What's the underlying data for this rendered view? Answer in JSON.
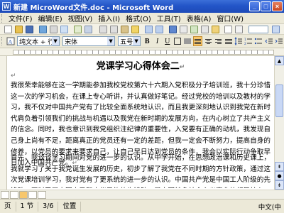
{
  "window": {
    "title": "新建 MicroWord文件.doc - Microsoft Word",
    "app_icon": "W",
    "minimize": "_",
    "maximize": "□",
    "close": "×"
  },
  "menu": [
    "文件(F)",
    "编辑(E)",
    "视图(V)",
    "插入(I)",
    "格式(O)",
    "工具(T)",
    "表格(A)",
    "窗口(W)"
  ],
  "format_toolbar": {
    "style": "纯文本 + 行距",
    "font": "宋体",
    "size": "五号",
    "bold": "B",
    "italic": "I",
    "underline": "U"
  },
  "document": {
    "title": "党课学习心得体会二",
    "paragraphs": [
      "我很荣幸能够在这一学期能参加我校党校第六十六期入党积极分子培训班，我十分珍惜这一次的学习机会，在课上专心听讲，并认真做好笔记。经过党校的培训以及教材的学习，我不仅对中国共产党有了比较全面系统地认识，而且我更深刻地认识到我党在新时代肩负着引领我们的挑战与机遇以及我党在新时期的发展方向，在内心树立了共产主义的信念。同时，我也意识到我党组织注纪律的重要性，入党要有正确的动机，我发现自己身上尚有不足，距离真正的党员还有一定的差距，但我一定会不断努力，提高自身的修养，以党员的要求来要求自己，让自己早日达到党员的条件，我会以实际行动争取早日加入中国共产党。",
      "首先，我谈谈学习期间对党的进一步的认识。从中学开始，在思想政治课和历史课上，我就学习了关于我党诞生发展的历史，初步了解了我党在不同时期的方针政策，通过这次党课培训学习，我对党有了更系统的进一步的认识。中国共产党是中国工人阶级的先锋队，同时又是中国人民和中华民族的先锋队，是中国特色社会主义事业的领导核心，代表中国先进生产力的发展要求，代表中国先进文化的前进方向，代表中国最广大人民的根本利益。(即三个代表)这"
    ]
  },
  "status": {
    "page": "页",
    "section": "1 节",
    "page_of": "3/6",
    "position": "位置",
    "language": "中文(中"
  }
}
